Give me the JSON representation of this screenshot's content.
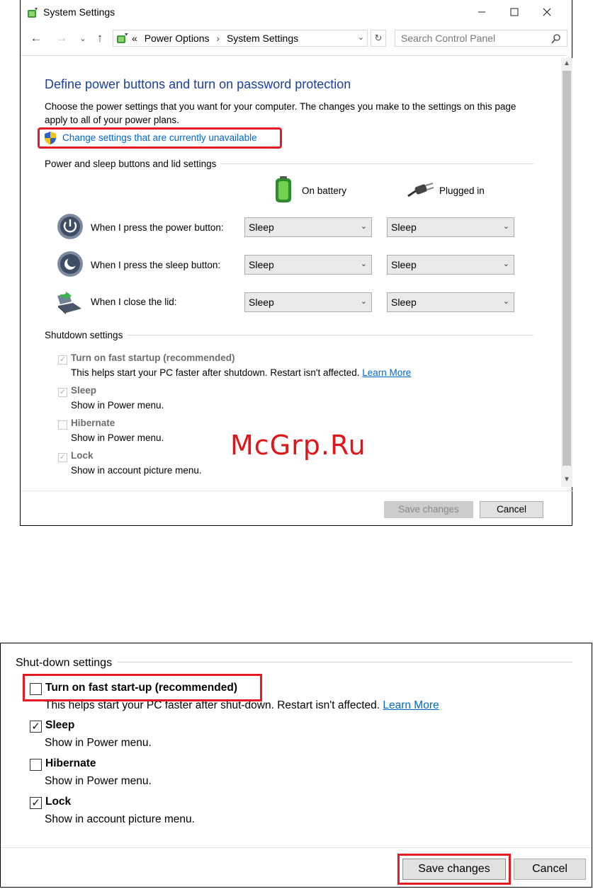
{
  "window1": {
    "title": "System Settings",
    "breadcrumb_prefix": "«",
    "breadcrumb": [
      "Power Options",
      "System Settings"
    ],
    "search_placeholder": "Search Control Panel",
    "heading": "Define power buttons and turn on password protection",
    "description": "Choose the power settings that you want for your computer. The changes you make to the settings on this page apply to all of your power plans.",
    "change_link": "Change settings that are currently unavailable",
    "buttons_group_title": "Power and sleep buttons and lid settings",
    "col_battery": "On battery",
    "col_plugged": "Plugged in",
    "rows": [
      {
        "label": "When I press the power button:",
        "battery": "Sleep",
        "plugged": "Sleep"
      },
      {
        "label": "When I press the sleep button:",
        "battery": "Sleep",
        "plugged": "Sleep"
      },
      {
        "label": "When I close the lid:",
        "battery": "Sleep",
        "plugged": "Sleep"
      }
    ],
    "shutdown_group_title": "Shutdown settings",
    "shutdown": [
      {
        "title": "Turn on fast startup (recommended)",
        "sub": "This helps start your PC faster after shutdown. Restart isn't affected.",
        "link": "Learn More",
        "checked": true
      },
      {
        "title": "Sleep",
        "sub": "Show in Power menu.",
        "checked": true
      },
      {
        "title": "Hibernate",
        "sub": "Show in Power menu.",
        "checked": false
      },
      {
        "title": "Lock",
        "sub": "Show in account picture menu.",
        "checked": true
      }
    ],
    "save_label": "Save changes",
    "cancel_label": "Cancel"
  },
  "window2": {
    "group_title": "Shut-down settings",
    "items": [
      {
        "title": "Turn on fast start-up (recommended)",
        "sub": "This helps start your PC faster after shut-down. Restart isn't affected.",
        "link": "Learn More",
        "checked": false
      },
      {
        "title": "Sleep",
        "sub": "Show in Power menu.",
        "checked": true
      },
      {
        "title": "Hibernate",
        "sub": "Show in Power menu.",
        "checked": false
      },
      {
        "title": "Lock",
        "sub": "Show in account picture menu.",
        "checked": true
      }
    ],
    "save_label": "Save changes",
    "cancel_label": "Cancel"
  },
  "watermark": "McGrp.Ru",
  "colors": {
    "accent_heading": "#1e3fa0",
    "link": "#0066cc",
    "highlight": "#e21b24"
  },
  "icons": {
    "app": "power-options-icon",
    "back": "back-arrow-icon",
    "forward": "forward-arrow-icon",
    "recent": "chevron-down-icon",
    "up": "up-arrow-icon",
    "refresh": "refresh-icon",
    "search": "search-icon",
    "shield": "uac-shield-icon",
    "battery": "battery-icon",
    "plug": "plug-icon"
  }
}
